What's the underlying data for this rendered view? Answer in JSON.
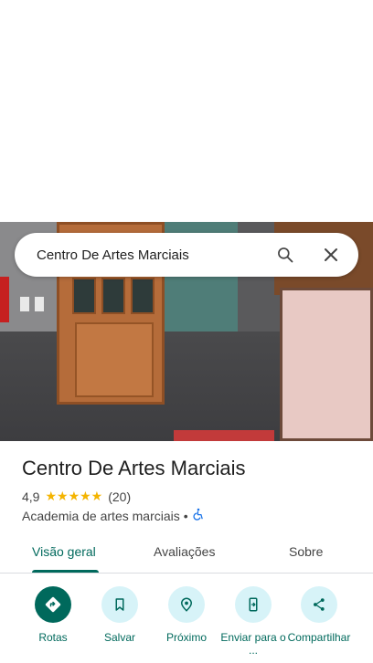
{
  "search": {
    "query": "Centro De Artes Marciais"
  },
  "place": {
    "name": "Centro De Artes Marciais",
    "rating": "4,9",
    "stars": "★★★★★",
    "review_count": "(20)",
    "category": "Academia de artes marciais",
    "separator": "•"
  },
  "tabs": [
    {
      "label": "Visão geral"
    },
    {
      "label": "Avaliações"
    },
    {
      "label": "Sobre"
    }
  ],
  "actions": [
    {
      "label": "Rotas",
      "icon": "directions-icon"
    },
    {
      "label": "Salvar",
      "icon": "bookmark-icon"
    },
    {
      "label": "Próximo",
      "icon": "nearby-icon"
    },
    {
      "label": "Enviar para o ...",
      "icon": "send-to-phone-icon"
    },
    {
      "label": "Compartilhar",
      "icon": "share-icon"
    }
  ],
  "colors": {
    "accent": "#00695c",
    "action_bg": "#d7f3f8",
    "star": "#f4b400",
    "accessible": "#1a73e8"
  }
}
